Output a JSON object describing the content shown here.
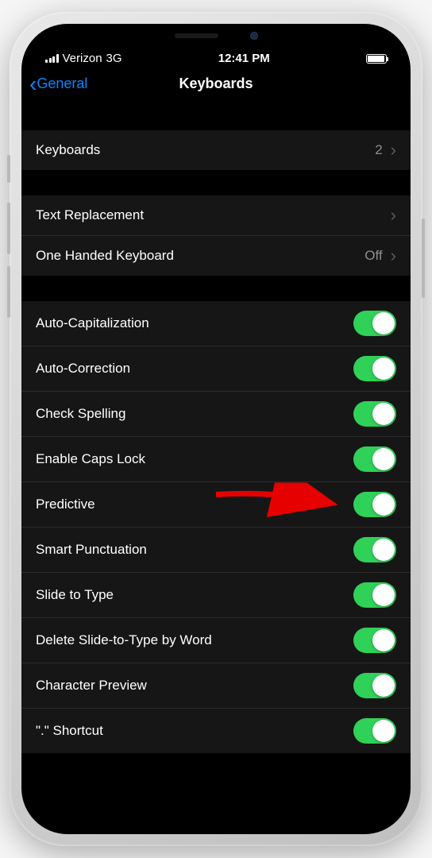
{
  "statusBar": {
    "carrier": "Verizon",
    "network": "3G",
    "time": "12:41 PM"
  },
  "navBar": {
    "back": "General",
    "title": "Keyboards"
  },
  "sections": {
    "keyboards": {
      "label": "Keyboards",
      "count": "2"
    },
    "textReplacement": {
      "label": "Text Replacement"
    },
    "oneHanded": {
      "label": "One Handed Keyboard",
      "value": "Off"
    },
    "toggles": {
      "autoCapitalization": "Auto-Capitalization",
      "autoCorrection": "Auto-Correction",
      "checkSpelling": "Check Spelling",
      "enableCapsLock": "Enable Caps Lock",
      "predictive": "Predictive",
      "smartPunctuation": "Smart Punctuation",
      "slideToType": "Slide to Type",
      "deleteSlide": "Delete Slide-to-Type by Word",
      "characterPreview": "Character Preview",
      "periodShortcut": "\".\" Shortcut"
    }
  }
}
